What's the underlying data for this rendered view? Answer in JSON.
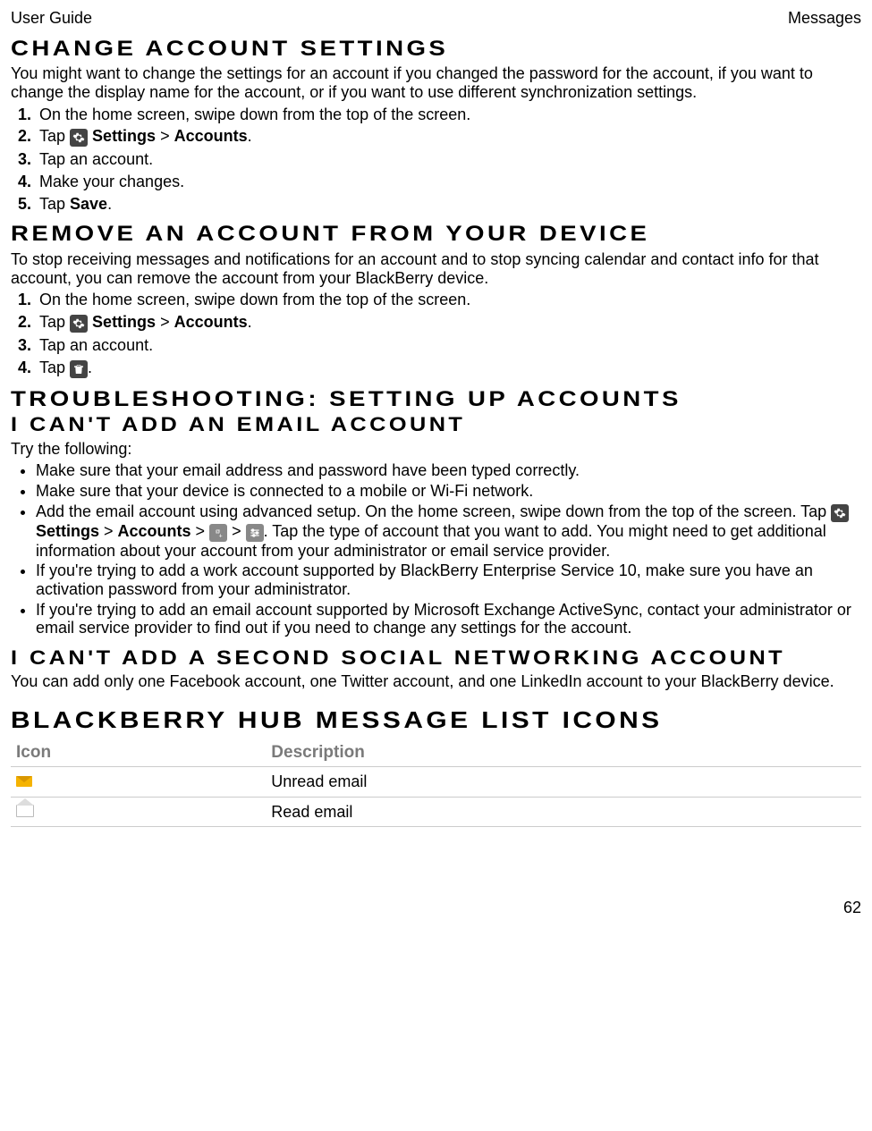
{
  "header": {
    "left": "User Guide",
    "right": "Messages"
  },
  "sections": {
    "change": {
      "title": "Change account settings",
      "intro": "You might want to change the settings for an account if you changed the password for the account, if you want to change the display name for the account, or if you want to use different synchronization settings.",
      "steps": {
        "s1": "On the home screen, swipe down from the top of the screen.",
        "s2_pre": "Tap ",
        "s2_settings": "Settings",
        "s2_gt": " > ",
        "s2_accounts": "Accounts",
        "s2_post": ".",
        "s3": "Tap an account.",
        "s4": "Make your changes.",
        "s5_pre": "Tap ",
        "s5_save": "Save",
        "s5_post": "."
      }
    },
    "remove": {
      "title": "Remove an account from your device",
      "intro": "To stop receiving messages and notifications for an account and to stop syncing calendar and contact info for that account, you can remove the account from your BlackBerry device.",
      "steps": {
        "s1": "On the home screen, swipe down from the top of the screen.",
        "s2_pre": "Tap ",
        "s2_settings": "Settings",
        "s2_gt": " > ",
        "s2_accounts": "Accounts",
        "s2_post": ".",
        "s3": "Tap an account.",
        "s4_pre": "Tap ",
        "s4_post": "."
      }
    },
    "troubleshoot": {
      "title": "Troubleshooting: Setting up accounts",
      "sub1": "I can't add an email account",
      "try": "Try the following:",
      "b1": "Make sure that your email address and password have been typed correctly.",
      "b2": "Make sure that your device is connected to a mobile or Wi-Fi network.",
      "b3_pre": "Add the email account using advanced setup. On the home screen, swipe down from the top of the screen. Tap ",
      "b3_settings": "Settings",
      "b3_gt1": " > ",
      "b3_accounts": "Accounts",
      "b3_gt2": " > ",
      "b3_gt3": " > ",
      "b3_post": ". Tap the type of account that you want to add. You might need to get additional information about your account from your administrator or email service provider.",
      "b4": "If you're trying to add a work account supported by BlackBerry Enterprise Service 10, make sure you have an activation password from your administrator.",
      "b5": "If you're trying to add an email account supported by Microsoft Exchange ActiveSync, contact your administrator or email service provider to find out if you need to change any settings for the account.",
      "sub2": "I can't add a second social networking account",
      "social": "You can add only one Facebook account, one Twitter account, and one LinkedIn account to your BlackBerry device."
    },
    "iconsTable": {
      "title": "BlackBerry Hub message list icons",
      "col1": "Icon",
      "col2": "Description",
      "row1": "Unread email",
      "row2": "Read email"
    }
  },
  "pageNumber": "62"
}
